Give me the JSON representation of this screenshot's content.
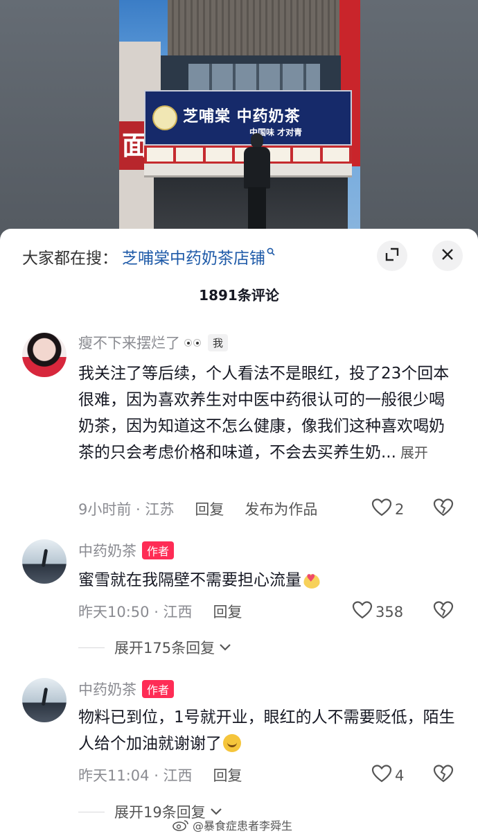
{
  "video": {
    "sign_title": "芝哺棠 中药奶茶",
    "sign_subtitle": "中国味 才对青",
    "side_sign": "面"
  },
  "sheet": {
    "search_prefix": "大家都在搜：",
    "search_term": "芝哺棠中药奶茶店铺",
    "comment_count": "1891条评论"
  },
  "comments": [
    {
      "username": "瘦不下来摆烂了",
      "tag": "我",
      "text": "我关注了等后续，个人看法不是眼红，投了23个回本很难，因为喜欢养生对中医中药很认可的一般很少喝奶茶，因为知道这不怎么健康，像我们这种喜欢喝奶茶的只会考虑价格和味道，不会去买养生奶...",
      "more": "展开",
      "time_location": "9小时前 · 江苏",
      "reply": "回复",
      "post_as_work": "发布为作品",
      "likes": "2"
    },
    {
      "username": "中药奶茶",
      "tag": "作者",
      "text": "蜜雪就在我隔壁不需要担心流量",
      "time_location": "昨天10:50 · 江西",
      "reply": "回复",
      "likes": "358",
      "expand_replies": "展开175条回复"
    },
    {
      "username": "中药奶茶",
      "tag": "作者",
      "text": "物料已到位，1号就开业，眼红的人不需要贬低，陌生人给个加油就谢谢了",
      "time_location": "昨天11:04 · 江西",
      "reply": "回复",
      "likes": "4",
      "expand_replies": "展开19条回复"
    }
  ],
  "watermark": "@暴食症患者李舜生",
  "colors": {
    "link_blue": "#1e5aa8",
    "author_tag": "#fe2c55",
    "text_primary": "#161823",
    "text_secondary": "#8a8b91"
  },
  "icons": [
    "search-icon",
    "expand-icon",
    "close-icon",
    "heart-icon",
    "dislike-icon",
    "chevron-down-icon",
    "weibo-icon"
  ]
}
